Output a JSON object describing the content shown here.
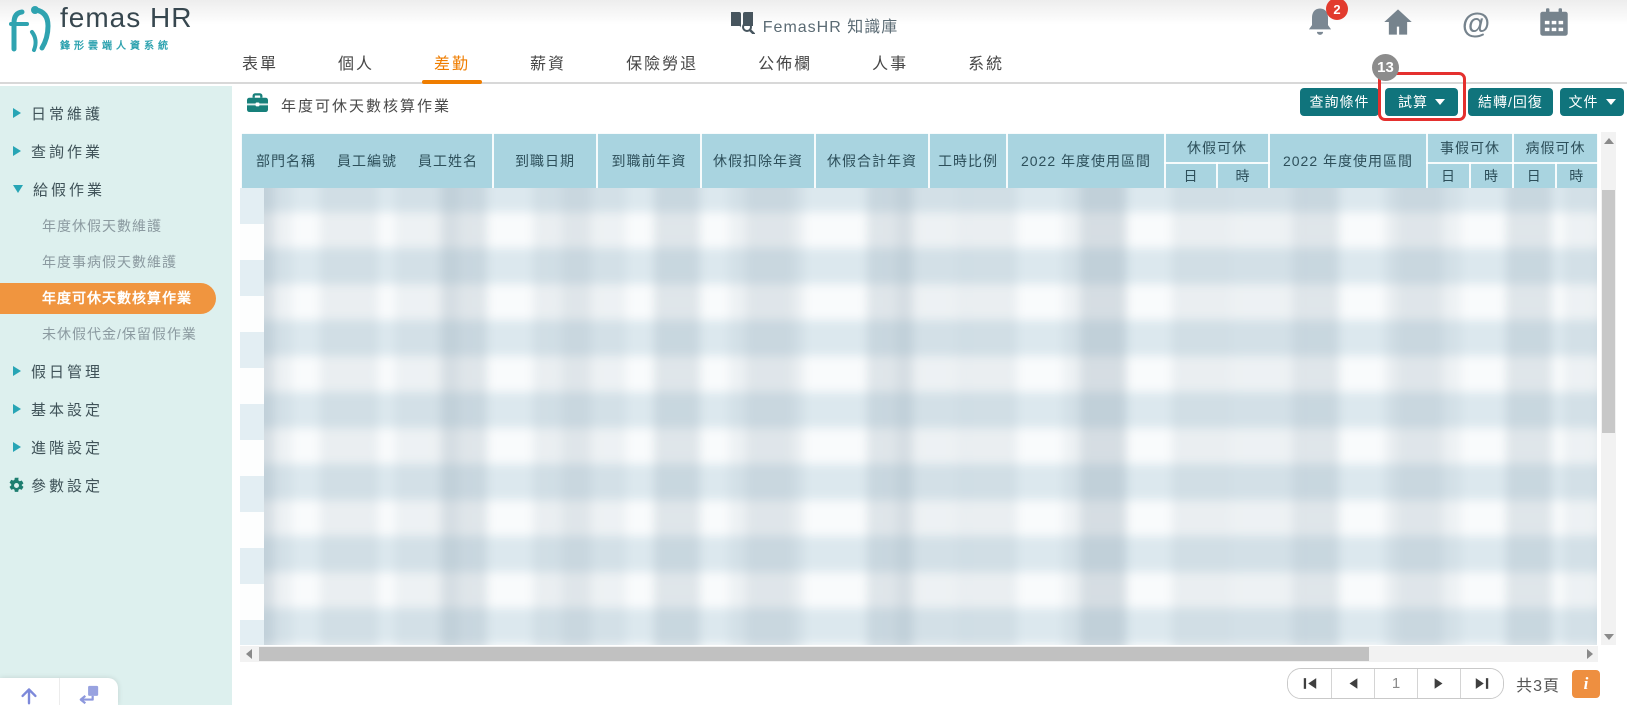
{
  "app": {
    "logo_title": "femas HR",
    "logo_subtitle": "鋒形雲端人資系統",
    "knowledge_base_label": "FemasHR 知識庫",
    "notification_count": "2"
  },
  "nav": {
    "items": [
      {
        "id": "forms",
        "label": "表單",
        "active": false
      },
      {
        "id": "personal",
        "label": "個人",
        "active": false
      },
      {
        "id": "attendance",
        "label": "差勤",
        "active": true
      },
      {
        "id": "payroll",
        "label": "薪資",
        "active": false
      },
      {
        "id": "insurance-pension",
        "label": "保險勞退",
        "active": false
      },
      {
        "id": "bulletin",
        "label": "公佈欄",
        "active": false
      },
      {
        "id": "hr",
        "label": "人事",
        "active": false
      },
      {
        "id": "system",
        "label": "系統",
        "active": false
      }
    ]
  },
  "sidebar": {
    "items": [
      {
        "id": "daily-maintenance",
        "label": "日常維護",
        "type": "group",
        "state": "collapsed",
        "active": false
      },
      {
        "id": "query-operations",
        "label": "查詢作業",
        "type": "group",
        "state": "collapsed",
        "active": false
      },
      {
        "id": "leave-granting",
        "label": "給假作業",
        "type": "group",
        "state": "expanded",
        "active": false
      },
      {
        "id": "annual-leave-days-maintenance",
        "label": "年度休假天數維護",
        "type": "sub",
        "active": false
      },
      {
        "id": "annual-personal-sick-days-maintenance",
        "label": "年度事病假天數維護",
        "type": "sub",
        "active": false
      },
      {
        "id": "annual-available-days-calculation",
        "label": "年度可休天數核算作業",
        "type": "sub",
        "active": true
      },
      {
        "id": "unused-leave-compensation",
        "label": "未休假代金/保留假作業",
        "type": "sub",
        "active": false
      },
      {
        "id": "holiday-management",
        "label": "假日管理",
        "type": "group",
        "state": "collapsed",
        "active": false
      },
      {
        "id": "basic-settings",
        "label": "基本設定",
        "type": "group",
        "state": "collapsed",
        "active": false
      },
      {
        "id": "advanced-settings",
        "label": "進階設定",
        "type": "group",
        "state": "collapsed",
        "active": false
      },
      {
        "id": "parameter-settings",
        "label": "參數設定",
        "type": "gear",
        "active": false
      }
    ]
  },
  "page": {
    "title": "年度可休天數核算作業"
  },
  "toolbar": {
    "query_conditions": "查詢條件",
    "trial_calculation": "試算",
    "transfer_restore": "結轉/回復",
    "document": "文件"
  },
  "annotation": {
    "step_number": "13"
  },
  "table": {
    "dept": "部門名稱",
    "emp_no": "員工編號",
    "emp_name": "員工姓名",
    "hire_date": "到職日期",
    "pre_hire_seniority": "到職前年資",
    "leave_deduct_seniority": "休假扣除年資",
    "leave_total_seniority": "休假合計年資",
    "work_hour_ratio": "工時比例",
    "usage_period_1": "2022 年度使用區間",
    "annual_leave_available": "休假可休",
    "usage_period_2": "2022 年度使用區間",
    "personal_leave_available": "事假可休",
    "sick_leave_available": "病假可休",
    "day": "日",
    "hour": "時",
    "blurred_row_count": 13
  },
  "pagination": {
    "current_page": "1",
    "total_pages_label": "共3頁",
    "info_label": "i"
  },
  "colors": {
    "accent_teal": "#10747c",
    "nav_active_orange": "#ef7d00",
    "sidebar_active_orange": "#f0953f",
    "table_header_blue": "#a9d4e0",
    "notification_red": "#e23b2e",
    "annotation_red": "#e4302e",
    "info_orange": "#ee8f40"
  }
}
